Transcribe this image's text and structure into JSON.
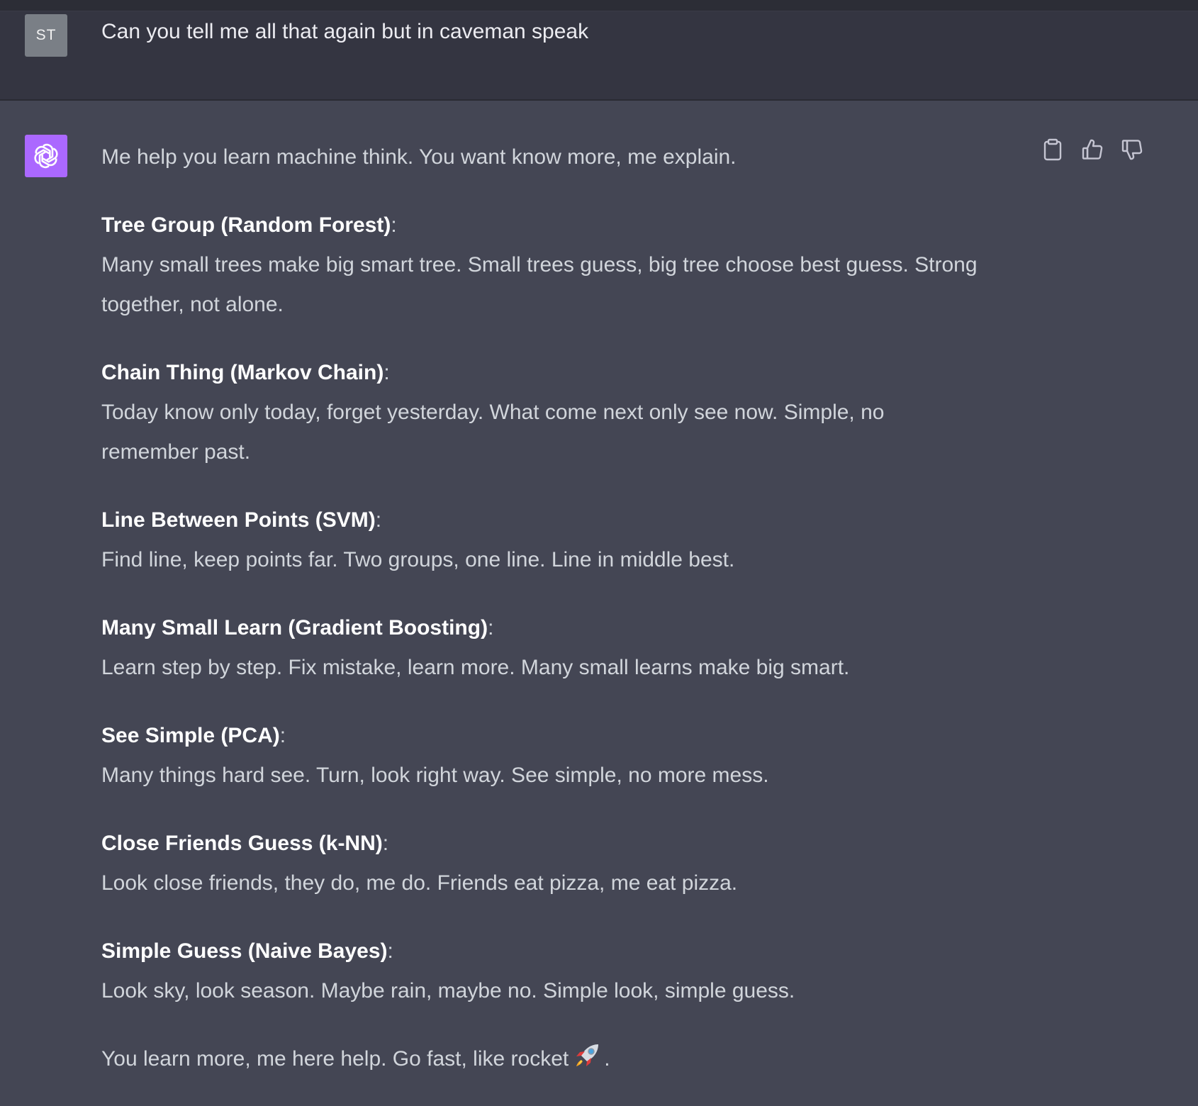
{
  "user": {
    "avatar_initials": "ST",
    "message": "Can you tell me all that again but in caveman speak"
  },
  "assistant": {
    "avatar_icon": "openai-logo-icon",
    "actions": [
      {
        "name": "copy-button",
        "icon": "clipboard-icon"
      },
      {
        "name": "thumbs-up-button",
        "icon": "thumbs-up-icon"
      },
      {
        "name": "thumbs-down-button",
        "icon": "thumbs-down-icon"
      }
    ],
    "intro": "Me help you learn machine think. You want know more, me explain.",
    "sections": [
      {
        "title": "Tree Group (Random Forest)",
        "body": "Many small trees make big smart tree. Small trees guess, big tree choose best guess. Strong together, not alone."
      },
      {
        "title": "Chain Thing (Markov Chain)",
        "body": "Today know only today, forget yesterday. What come next only see now. Simple, no remember past."
      },
      {
        "title": "Line Between Points (SVM)",
        "body": "Find line, keep points far. Two groups, one line. Line in middle best."
      },
      {
        "title": "Many Small Learn (Gradient Boosting)",
        "body": "Learn step by step. Fix mistake, learn more. Many small learns make big smart."
      },
      {
        "title": "See Simple (PCA)",
        "body": "Many things hard see. Turn, look right way. See simple, no more mess."
      },
      {
        "title": "Close Friends Guess (k-NN)",
        "body": "Look close friends, they do, me do. Friends eat pizza, me eat pizza."
      },
      {
        "title": "Simple Guess (Naive Bayes)",
        "body": "Look sky, look season. Maybe rain, maybe no. Simple look, simple guess."
      }
    ],
    "outro_text": "You learn more, me here help. Go fast, like rocket",
    "outro_end": "."
  },
  "colors": {
    "user_bg": "#343541",
    "assistant_bg": "#444654",
    "bot_avatar": "#ab68ff",
    "user_avatar": "#7a7f86",
    "text": "#d1d5db"
  }
}
